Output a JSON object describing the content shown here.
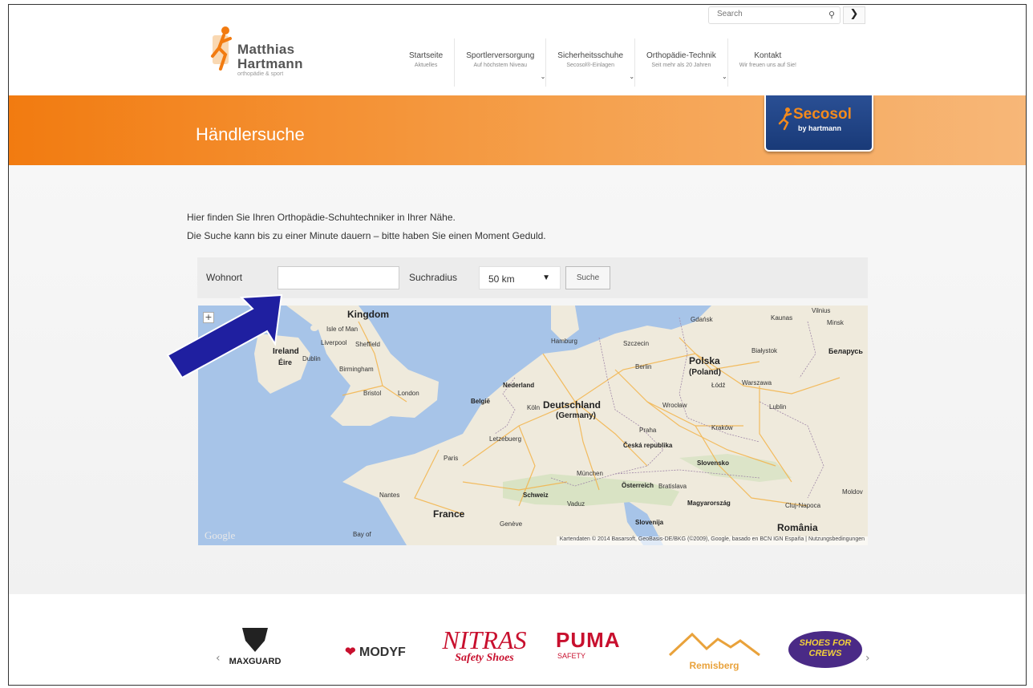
{
  "header": {
    "search_placeholder": "Search",
    "logo": {
      "line1": "Matthias",
      "line2": "Hartmann",
      "tagline": "orthopädie & sport"
    },
    "nav": [
      {
        "title": "Startseite",
        "subtitle": "Aktuelles",
        "has_dropdown": false
      },
      {
        "title": "Sportlerversorgung",
        "subtitle": "Auf höchstem Niveau",
        "has_dropdown": true
      },
      {
        "title": "Sicherheitsschuhe",
        "subtitle": "Secosol®-Einlagen",
        "has_dropdown": true
      },
      {
        "title": "Orthopädie-Technik",
        "subtitle": "Seit mehr als 20 Jahren",
        "has_dropdown": true
      },
      {
        "title": "Kontakt",
        "subtitle": "Wir freuen uns auf Sie!",
        "has_dropdown": false
      }
    ]
  },
  "banner": {
    "title": "Händlersuche",
    "badge": {
      "brand": "Secosol",
      "by": "by hartmann"
    }
  },
  "intro": {
    "line1": "Hier finden Sie Ihren Orthopädie-Schuhtechniker in Ihrer Nähe.",
    "line2": "Die Suche kann bis zu einer Minute dauern – bitte haben Sie einen Moment Geduld."
  },
  "form": {
    "wohnort_label": "Wohnort",
    "wohnort_value": "",
    "radius_label": "Suchradius",
    "radius_value": "50 km",
    "search_button": "Suche"
  },
  "map": {
    "zoom_label": "+",
    "watermark": "Google",
    "attribution": "Kartendaten © 2014 Basarsoft, GeoBasis-DE/BKG (©2009), Google, basado en BCN IGN España | Nutzungsbedingungen",
    "countries": [
      "Kingdom",
      "Ireland",
      "Éire",
      "Nederland",
      "België",
      "Deutschland",
      "(Germany)",
      "Polska",
      "(Poland)",
      "France",
      "Česká republika",
      "Slovensko",
      "Österreich",
      "Magyarország",
      "România",
      "Schweiz",
      "Slovenija",
      "Беларусь"
    ],
    "cities": [
      "Isle of Man",
      "Liverpool",
      "Sheffield",
      "Dublin",
      "Birmingham",
      "Bristol",
      "London",
      "Hamburg",
      "Szczecin",
      "Gdańsk",
      "Kaunas",
      "Vilnius",
      "Minsk",
      "Berlin",
      "Białystok",
      "Łódź",
      "Warszawa",
      "Wrocław",
      "Lublin",
      "Köln",
      "Praha",
      "Kraków",
      "Letzebuerg",
      "Paris",
      "München",
      "Bratislava",
      "Nantes",
      "Vaduz",
      "Genève",
      "Cluj-Napoca",
      "Moldov",
      "Bay of"
    ]
  },
  "brands": [
    "MAXGUARD",
    "MODYF",
    "NITRAS",
    "Safety Shoes",
    "PUMA",
    "SAFETY",
    "Remisberg",
    "SHOES FOR CREWS"
  ],
  "colors": {
    "orange": "#f27b10",
    "navy": "#1e3f82",
    "arrow": "#1f1fa0"
  }
}
